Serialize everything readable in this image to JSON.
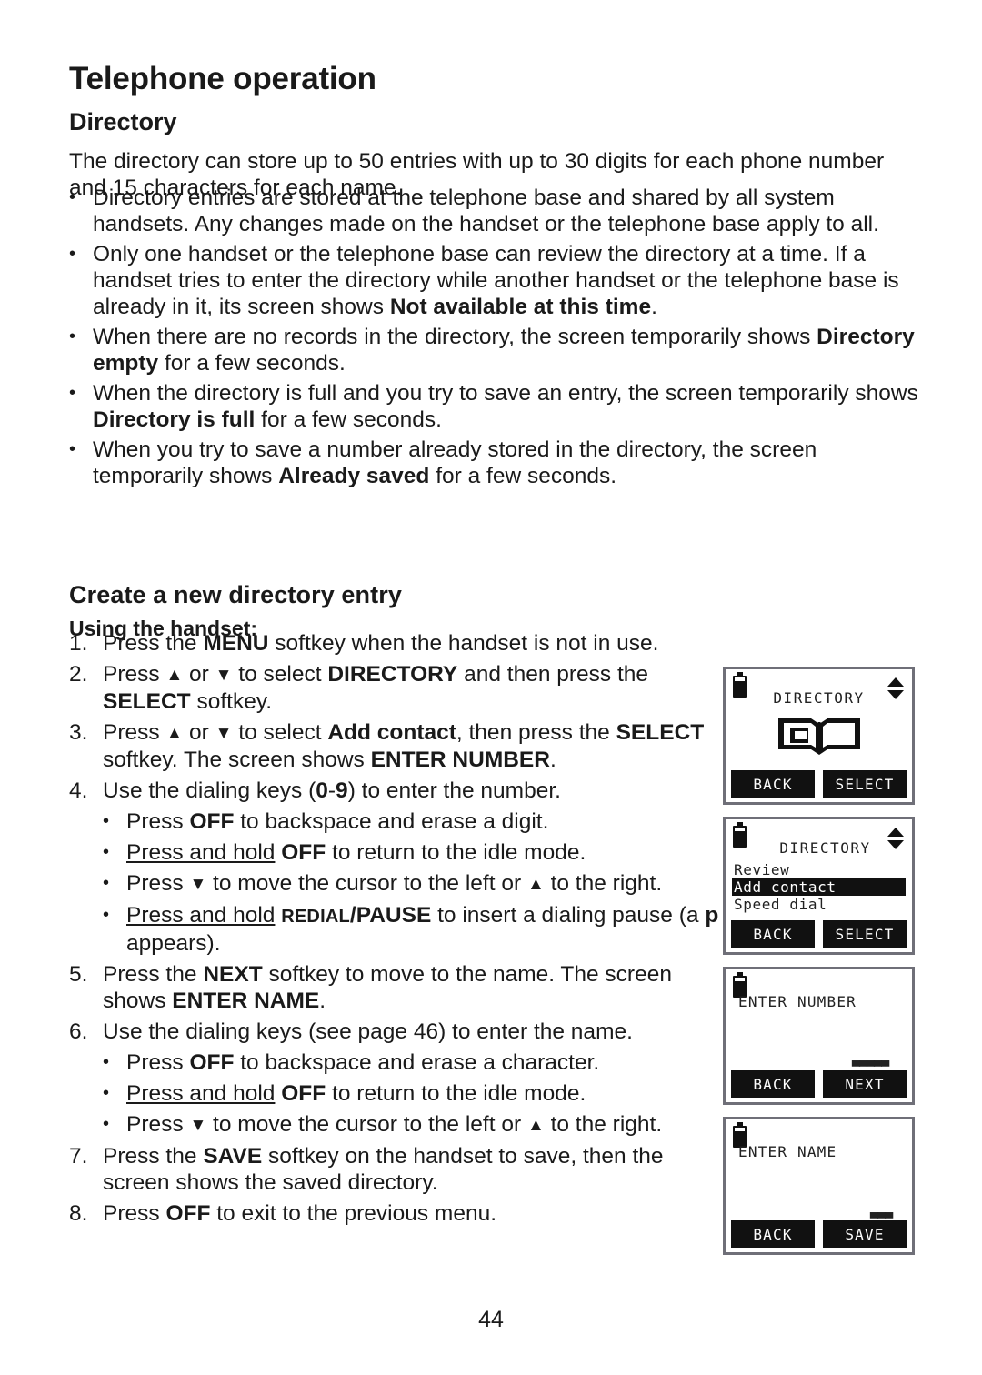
{
  "page": {
    "chapter_title": "Telephone operation",
    "section_title": "Directory",
    "page_number": "44"
  },
  "intro": {
    "text": "The directory can store up to 50 entries with up to 30 digits for each phone number and 15 characters for each name."
  },
  "bullets": [
    {
      "mark": "•",
      "parts": [
        {
          "t": "Directory entries are stored at the telephone base and shared by all system handsets. Any changes made on the handset or the telephone base apply to all.",
          "style": "normal"
        }
      ]
    },
    {
      "mark": "•",
      "parts": [
        {
          "t": "Only one handset or the telephone base can review the directory at a time. If a handset tries to enter the directory while another handset or the telephone base is already in it, its screen shows ",
          "style": "normal"
        },
        {
          "t": "Not available at this time",
          "style": "bold"
        },
        {
          "t": ".",
          "style": "normal"
        }
      ]
    },
    {
      "mark": "•",
      "parts": [
        {
          "t": "When there are no records in the directory, the screen temporarily shows ",
          "style": "normal"
        },
        {
          "t": "Directory empty",
          "style": "bold"
        },
        {
          "t": " for a few seconds.",
          "style": "normal"
        }
      ]
    },
    {
      "mark": "•",
      "parts": [
        {
          "t": "When the directory is full and you try to save an entry, the screen temporarily shows ",
          "style": "normal"
        },
        {
          "t": "Directory is full",
          "style": "bold"
        },
        {
          "t": " for a few seconds.",
          "style": "normal"
        }
      ]
    },
    {
      "mark": "•",
      "parts": [
        {
          "t": "When you try to save a number already stored in the directory, the screen temporarily shows ",
          "style": "normal"
        },
        {
          "t": "Already saved",
          "style": "bold"
        },
        {
          "t": " for a few seconds.",
          "style": "normal"
        }
      ]
    }
  ],
  "create_entry": {
    "title": "Create a new directory entry",
    "subtitle": "Using the handset:",
    "steps": [
      {
        "num": "1.",
        "parts": [
          {
            "t": "Press the ",
            "style": "normal"
          },
          {
            "t": "MENU",
            "style": "bold"
          },
          {
            "t": " softkey when the handset is not in use.",
            "style": "normal"
          }
        ],
        "sub": []
      },
      {
        "num": "2.",
        "parts": [
          {
            "t": "Press ",
            "style": "normal"
          },
          {
            "t": "▲",
            "style": "arrow"
          },
          {
            "t": " or ",
            "style": "normal"
          },
          {
            "t": "▼",
            "style": "arrow"
          },
          {
            "t": " to select ",
            "style": "normal"
          },
          {
            "t": "DIRECTORY",
            "style": "bold"
          },
          {
            "t": " and then press the ",
            "style": "normal"
          },
          {
            "t": "SELECT",
            "style": "bold"
          },
          {
            "t": " softkey.",
            "style": "normal"
          }
        ],
        "sub": []
      },
      {
        "num": "3.",
        "parts": [
          {
            "t": "Press ",
            "style": "normal"
          },
          {
            "t": "▲",
            "style": "arrow"
          },
          {
            "t": " or ",
            "style": "normal"
          },
          {
            "t": "▼",
            "style": "arrow"
          },
          {
            "t": " to select ",
            "style": "normal"
          },
          {
            "t": "Add contact",
            "style": "bold"
          },
          {
            "t": ", then press the ",
            "style": "normal"
          },
          {
            "t": "SELECT",
            "style": "bold"
          },
          {
            "t": " softkey. The screen shows ",
            "style": "normal"
          },
          {
            "t": "ENTER NUMBER",
            "style": "bold"
          },
          {
            "t": ".",
            "style": "normal"
          }
        ],
        "sub": []
      },
      {
        "num": "4.",
        "parts": [
          {
            "t": "Use the dialing keys (",
            "style": "normal"
          },
          {
            "t": "0",
            "style": "bold"
          },
          {
            "t": "-",
            "style": "normal"
          },
          {
            "t": "9",
            "style": "bold"
          },
          {
            "t": ") to enter the number.",
            "style": "normal"
          }
        ],
        "sub": [
          {
            "mark": "•",
            "parts": [
              {
                "t": "Press ",
                "style": "normal"
              },
              {
                "t": "OFF",
                "style": "bold"
              },
              {
                "t": " to backspace and erase a digit.",
                "style": "normal"
              }
            ]
          },
          {
            "mark": "•",
            "parts": [
              {
                "t": "Press and hold",
                "style": "underline"
              },
              {
                "t": " ",
                "style": "normal"
              },
              {
                "t": "OFF",
                "style": "bold"
              },
              {
                "t": " to return to the idle mode.",
                "style": "normal"
              }
            ]
          },
          {
            "mark": "•",
            "parts": [
              {
                "t": "Press ",
                "style": "normal"
              },
              {
                "t": "▼",
                "style": "arrow"
              },
              {
                "t": " to move the cursor to the left or ",
                "style": "normal"
              },
              {
                "t": "▲",
                "style": "arrow"
              },
              {
                "t": " to the right.",
                "style": "normal"
              }
            ]
          },
          {
            "mark": "•",
            "parts": [
              {
                "t": "Press and hold",
                "style": "underline"
              },
              {
                "t": " ",
                "style": "normal"
              },
              {
                "t": "REDIAL",
                "style": "smallcaps"
              },
              {
                "t": "/PAUSE",
                "style": "bold"
              },
              {
                "t": "  to insert a dialing pause (a ",
                "style": "normal"
              },
              {
                "t": "p",
                "style": "bold"
              },
              {
                "t": " appears).",
                "style": "normal"
              }
            ]
          }
        ]
      },
      {
        "num": "5.",
        "parts": [
          {
            "t": "Press the ",
            "style": "normal"
          },
          {
            "t": "NEXT",
            "style": "bold"
          },
          {
            "t": " softkey to move to the name. The screen shows ",
            "style": "normal"
          },
          {
            "t": "ENTER NAME",
            "style": "bold"
          },
          {
            "t": ".",
            "style": "normal"
          }
        ],
        "sub": []
      },
      {
        "num": "6.",
        "parts": [
          {
            "t": "Use the dialing keys (see page 46) to enter the name.",
            "style": "normal"
          }
        ],
        "sub": [
          {
            "mark": "•",
            "parts": [
              {
                "t": "Press ",
                "style": "normal"
              },
              {
                "t": "OFF",
                "style": "bold"
              },
              {
                "t": " to backspace and erase a character.",
                "style": "normal"
              }
            ]
          },
          {
            "mark": "•",
            "parts": [
              {
                "t": "Press and hold",
                "style": "underline"
              },
              {
                "t": " ",
                "style": "normal"
              },
              {
                "t": "OFF",
                "style": "bold"
              },
              {
                "t": " to return to the idle mode.",
                "style": "normal"
              }
            ]
          },
          {
            "mark": "•",
            "parts": [
              {
                "t": "Press ",
                "style": "normal"
              },
              {
                "t": "▼",
                "style": "arrow"
              },
              {
                "t": " to move the cursor to the left or ",
                "style": "normal"
              },
              {
                "t": "▲",
                "style": "arrow"
              },
              {
                "t": " to the right.",
                "style": "normal"
              }
            ]
          }
        ]
      },
      {
        "num": "7.",
        "parts": [
          {
            "t": "Press the ",
            "style": "normal"
          },
          {
            "t": "SAVE",
            "style": "bold"
          },
          {
            "t": " softkey on the handset to save, then the screen shows the saved directory.",
            "style": "normal"
          }
        ],
        "sub": []
      },
      {
        "num": "8.",
        "parts": [
          {
            "t": "Press ",
            "style": "normal"
          },
          {
            "t": "OFF",
            "style": "bold"
          },
          {
            "t": " to exit to the previous menu.",
            "style": "normal"
          }
        ],
        "sub": []
      }
    ]
  },
  "lcd_screens": [
    {
      "id": "directory-icon-screen",
      "battery": true,
      "updown": true,
      "title": "DIRECTORY",
      "title_align": "center",
      "book_icon": true,
      "menu": [],
      "cursor": "",
      "softkeys": [
        "BACK",
        "SELECT"
      ]
    },
    {
      "id": "directory-menu-screen",
      "battery": true,
      "updown": true,
      "title": "DIRECTORY",
      "title_align": "center-shift",
      "book_icon": false,
      "menu": [
        {
          "label": "Review",
          "selected": false
        },
        {
          "label": "Add contact",
          "selected": true
        },
        {
          "label": "Speed dial",
          "selected": false
        }
      ],
      "cursor": "",
      "softkeys": [
        "BACK",
        "SELECT"
      ]
    },
    {
      "id": "enter-number-screen",
      "battery": true,
      "updown": false,
      "title": "ENTER NUMBER",
      "title_align": "left",
      "book_icon": false,
      "menu": [],
      "cursor": "▃▃▃▃▃",
      "softkeys": [
        "BACK",
        "NEXT"
      ]
    },
    {
      "id": "enter-name-screen",
      "battery": true,
      "updown": false,
      "title": "ENTER NAME",
      "title_align": "left",
      "book_icon": false,
      "menu": [],
      "cursor": "▃▃▃",
      "softkeys": [
        "BACK",
        "SAVE"
      ]
    }
  ],
  "colors": {
    "text": "#1a1a1a",
    "lcd_border": "#6f6f78",
    "lcd_fill": "#111111"
  }
}
